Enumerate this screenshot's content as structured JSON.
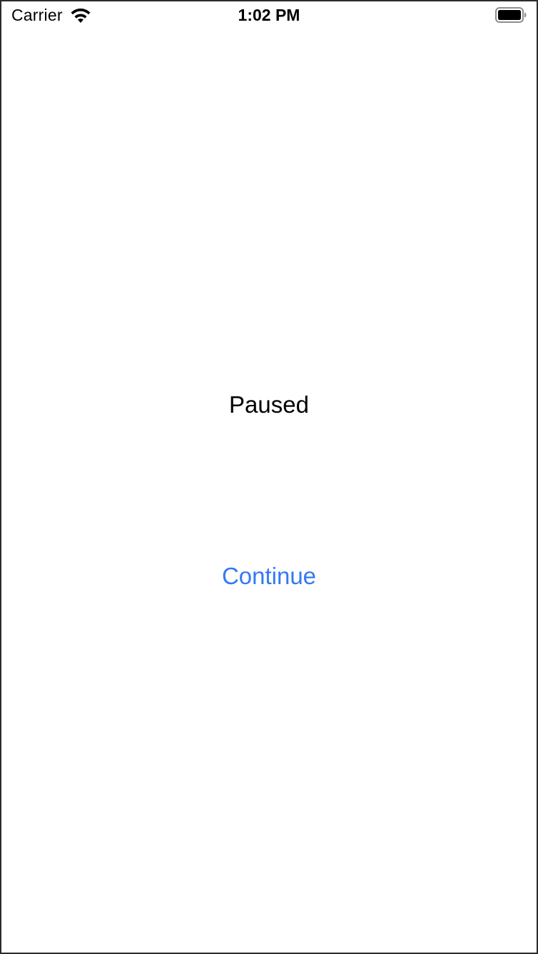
{
  "status_bar": {
    "carrier": "Carrier",
    "time": "1:02 PM",
    "wifi_icon": "wifi-icon",
    "battery_icon": "battery-full-icon"
  },
  "main": {
    "status_text": "Paused",
    "continue_label": "Continue"
  },
  "colors": {
    "accent": "#3478f6",
    "text": "#000000",
    "background": "#ffffff"
  }
}
